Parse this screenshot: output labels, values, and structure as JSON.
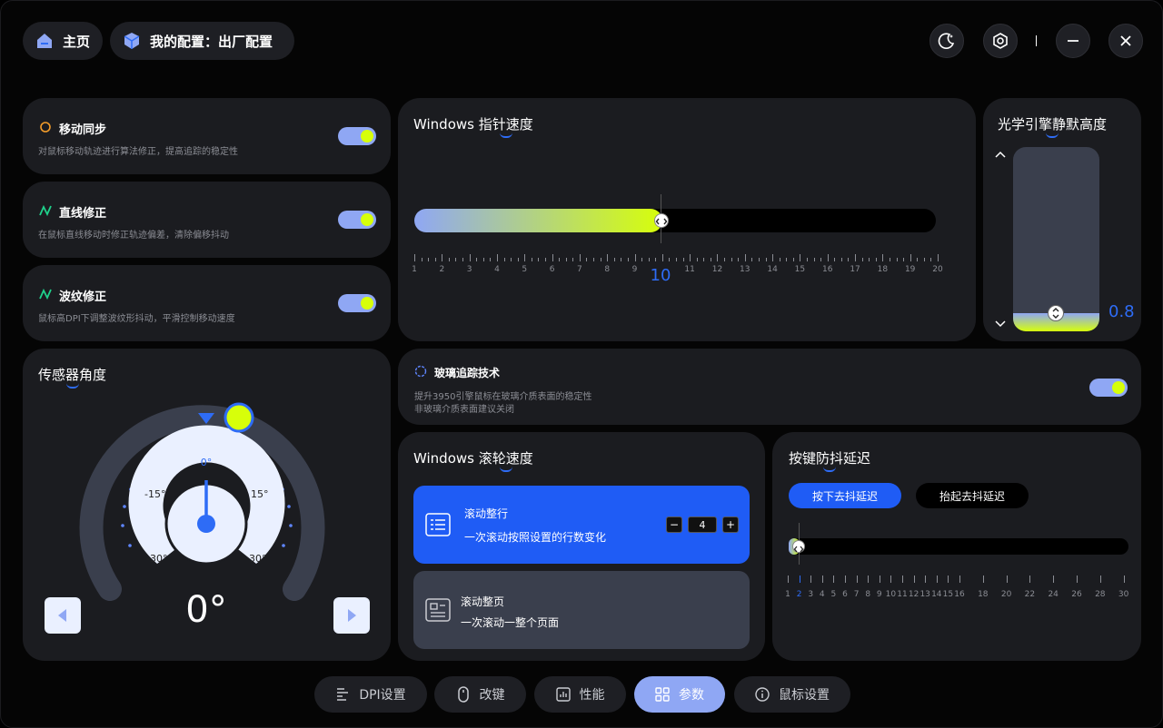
{
  "header": {
    "home_label": "主页",
    "config_label": "我的配置：出厂配置"
  },
  "features": [
    {
      "title": "移动同步",
      "desc": "对鼠标移动轨迹进行算法修正，提高追踪的稳定性",
      "enabled": true
    },
    {
      "title": "直线修正",
      "desc": "在鼠标直线移动时修正轨迹偏差，清除偏移抖动",
      "enabled": true
    },
    {
      "title": "波纹修正",
      "desc": "鼠标高DPI下调整波纹形抖动，平滑控制移动速度",
      "enabled": true
    }
  ],
  "pointer_speed": {
    "title_prefix": "Windows ",
    "title_main": "指针速度",
    "value": "10",
    "ticks": [
      "1",
      "2",
      "3",
      "4",
      "5",
      "6",
      "7",
      "8",
      "9",
      "10",
      "11",
      "12",
      "13",
      "14",
      "15",
      "16",
      "17",
      "18",
      "19",
      "20"
    ],
    "min": 1,
    "max": 20
  },
  "lod": {
    "title": "光学引擎静默高度",
    "value": "0.8"
  },
  "sensor": {
    "title": "传感器角度",
    "value": "0°",
    "marks": [
      "0°",
      "-15°",
      "15°",
      "-30°",
      "30°"
    ]
  },
  "glass": {
    "title": "玻璃追踪技术",
    "desc1": "提升3950引擎鼠标在玻璃介质表面的稳定性",
    "desc2": "非玻璃介质表面建议关闭",
    "enabled": true
  },
  "scroll": {
    "title_prefix": "Windows ",
    "title_main": "滚轮速度",
    "option1_title": "滚动整行",
    "option1_desc": "一次滚动按照设置的行数变化",
    "option1_value": "4",
    "minus": "−",
    "plus": "+",
    "option2_title": "滚动整页",
    "option2_desc": "一次滚动一整个页面"
  },
  "debounce": {
    "title": "按键防抖延迟",
    "tab_press": "按下去抖延迟",
    "tab_release": "抬起去抖延迟",
    "selected": "2",
    "ticks": [
      "1",
      "2",
      "3",
      "4",
      "5",
      "6",
      "7",
      "8",
      "9",
      "10",
      "11",
      "12",
      "13",
      "14",
      "15",
      "16",
      "18",
      "20",
      "22",
      "24",
      "26",
      "28",
      "30"
    ]
  },
  "bottom_nav": [
    {
      "label": "DPI设置",
      "icon": "dpi-icon"
    },
    {
      "label": "改键",
      "icon": "mouse-icon"
    },
    {
      "label": "性能",
      "icon": "chart-icon"
    },
    {
      "label": "参数",
      "icon": "grid-icon",
      "active": true
    },
    {
      "label": "鼠标设置",
      "icon": "info-icon"
    }
  ],
  "colors": {
    "accent_blue": "#2e6cf6",
    "lime": "#d7ff0a",
    "periwinkle": "#8fa7f4",
    "card_bg": "#1b1c20"
  }
}
